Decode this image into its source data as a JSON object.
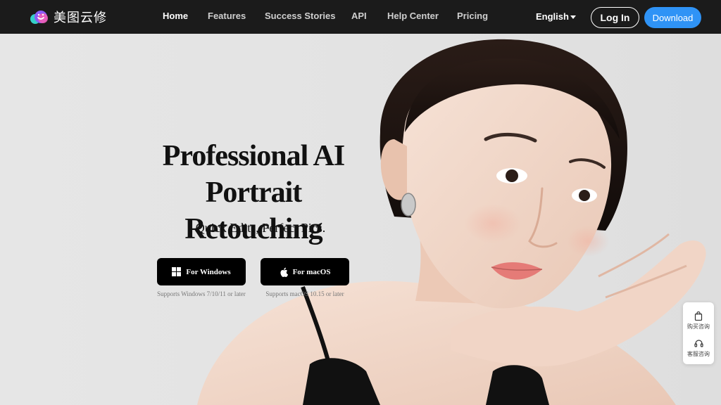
{
  "brand": {
    "logo_text": "美图云修",
    "colors": {
      "mark_cyan": "#35d0c8",
      "mark_purple": "#8a5cf6",
      "mark_pink": "#f05fb8"
    }
  },
  "nav": {
    "items": [
      {
        "label": "Home",
        "active": true
      },
      {
        "label": "Features",
        "active": false
      },
      {
        "label": "Success Stories",
        "active": false
      },
      {
        "label": "API",
        "active": false
      },
      {
        "label": "Help Center",
        "active": false
      },
      {
        "label": "Pricing",
        "active": false
      }
    ],
    "language": "English",
    "login_label": "Log In",
    "download_label": "Download"
  },
  "hero": {
    "title_line1": "Professional AI Portrait",
    "title_line2": "Retouching",
    "subtitle": "Quick Edits, Perfect Pics.",
    "windows": {
      "label": "For Windows",
      "note": "Supports Windows 7/10/11 or later",
      "icon": "windows-icon"
    },
    "mac": {
      "label": "For macOS",
      "note": "Supports macOS 10.15 or later",
      "icon": "apple-icon"
    }
  },
  "side_widget": {
    "purchase_label": "购买咨询",
    "purchase_icon": "shopping-bag-icon",
    "service_label": "客服咨询",
    "service_icon": "headset-icon"
  },
  "colors": {
    "topbar": "#1b1b1b",
    "accent": "#2f93f6",
    "hero_bg": "#e4e4e4"
  }
}
